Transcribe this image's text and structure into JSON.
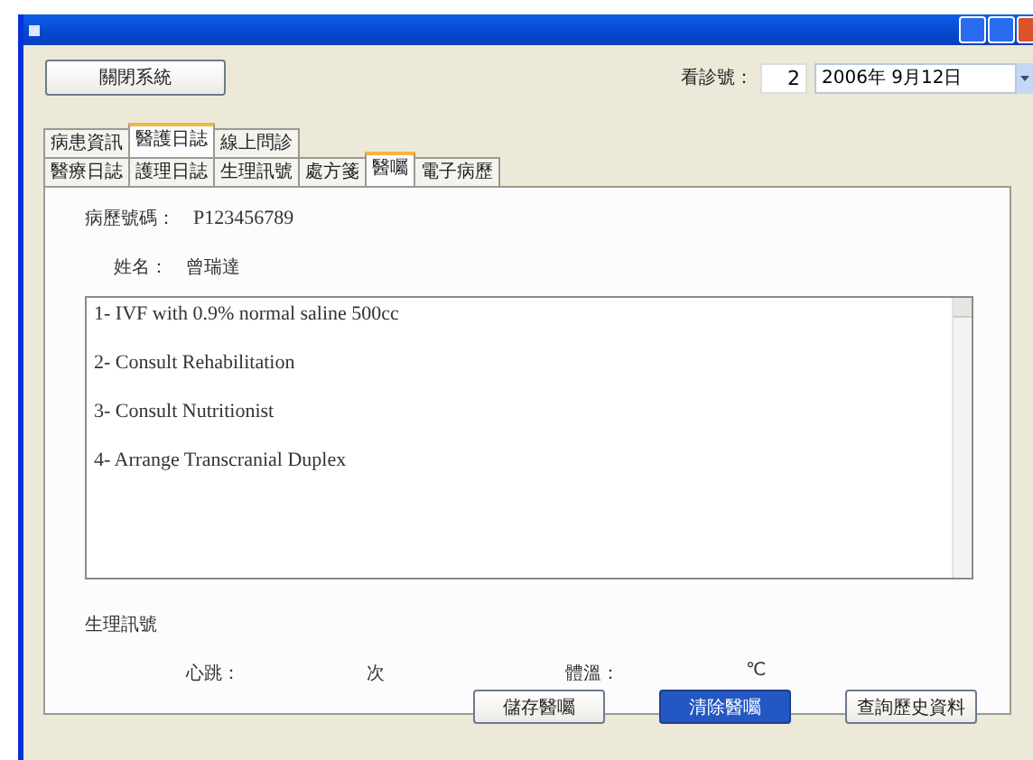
{
  "toolbar": {
    "close_system_button": "關閉系統",
    "visit_number_label": "看診號：",
    "visit_number": "2",
    "date": "2006年 9月12日"
  },
  "tabs": [
    {
      "label": "病患資訊",
      "selected": false
    },
    {
      "label": "醫護日誌",
      "selected": true
    },
    {
      "label": "線上問診",
      "selected": false
    }
  ],
  "subtabs": [
    {
      "label": "醫療日誌",
      "selected": false
    },
    {
      "label": "護理日誌",
      "selected": false
    },
    {
      "label": "生理訊號",
      "selected": false
    },
    {
      "label": "處方箋",
      "selected": false
    },
    {
      "label": "醫囑",
      "selected": true
    },
    {
      "label": "電子病歷",
      "selected": false
    }
  ],
  "patient": {
    "record_label": "病歷號碼：",
    "record_number": "P123456789",
    "name_label": "姓名：",
    "name": "曾瑞達"
  },
  "orders": [
    "1- IVF with 0.9% normal saline 500cc",
    "2- Consult Rehabilitation",
    "3- Consult Nutritionist",
    "4- Arrange Transcranial Duplex"
  ],
  "vitals": {
    "title": "生理訊號",
    "heart_label": "心跳：",
    "heart_unit": "次",
    "temp_label": "體溫：",
    "temp_unit": "℃"
  },
  "buttons": [
    {
      "label": "儲存醫囑",
      "focused": false
    },
    {
      "label": "清除醫囑",
      "focused": true
    },
    {
      "label": "查詢歷史資料",
      "focused": false
    }
  ]
}
